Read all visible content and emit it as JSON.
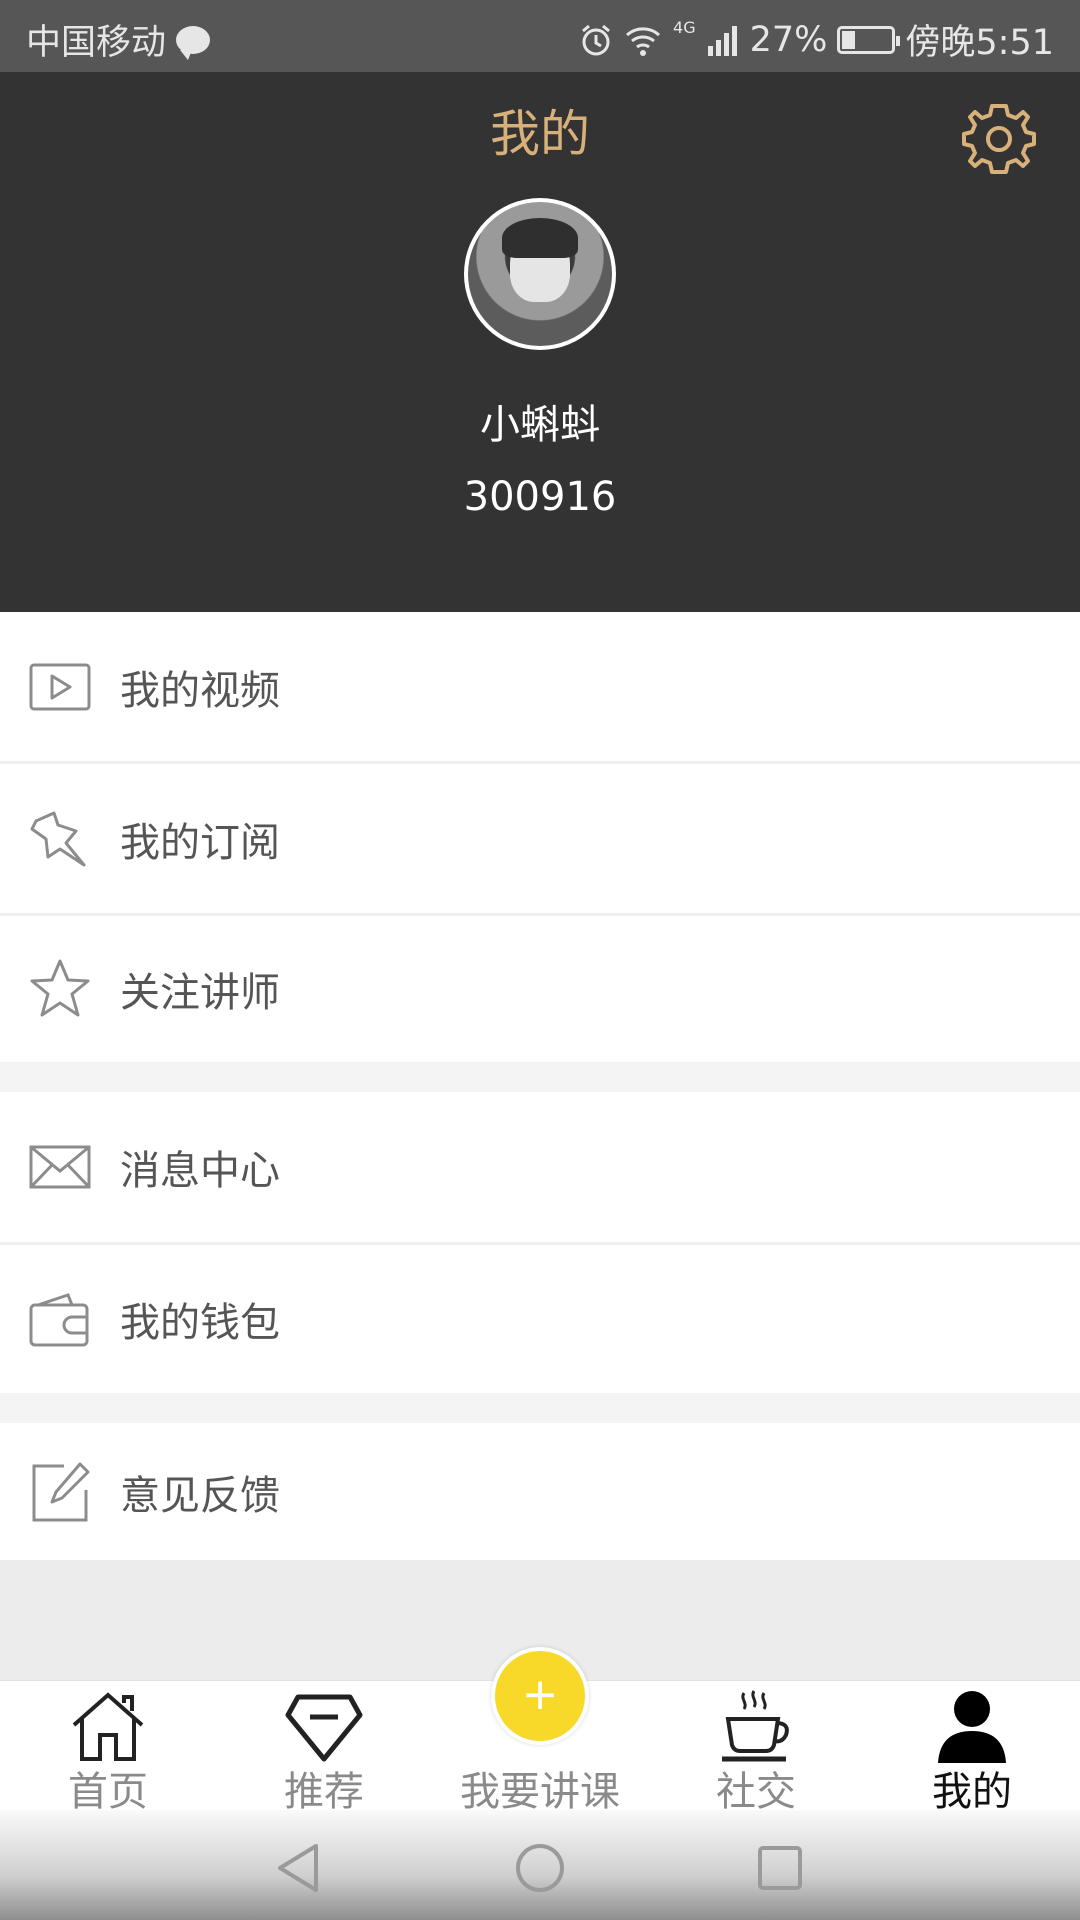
{
  "status_bar": {
    "carrier": "中国移动",
    "network": "4G",
    "battery": "27%",
    "battery_level": 0.27,
    "time": "傍晚5:51"
  },
  "header": {
    "title": "我的",
    "username": "小蝌蚪",
    "user_id": "300916",
    "accent_color": "#d7b07a",
    "background_color": "#333333"
  },
  "menu": {
    "items": [
      {
        "label": "我的视频",
        "icon": "video-play-icon"
      },
      {
        "label": "我的订阅",
        "icon": "pin-icon"
      },
      {
        "label": "关注讲师",
        "icon": "star-icon"
      },
      {
        "label": "消息中心",
        "icon": "mail-icon"
      },
      {
        "label": "我的钱包",
        "icon": "wallet-icon"
      },
      {
        "label": "意见反馈",
        "icon": "edit-icon"
      }
    ]
  },
  "bottom_nav": {
    "tabs": [
      {
        "label": "首页",
        "icon": "home-icon"
      },
      {
        "label": "推荐",
        "icon": "diamond-icon"
      },
      {
        "label": "我要讲课",
        "icon": "plus-icon"
      },
      {
        "label": "社交",
        "icon": "coffee-cup-icon"
      },
      {
        "label": "我的",
        "icon": "person-icon"
      }
    ],
    "active": "我的",
    "fab_symbol": "+",
    "fab_color": "#f8d92a"
  }
}
